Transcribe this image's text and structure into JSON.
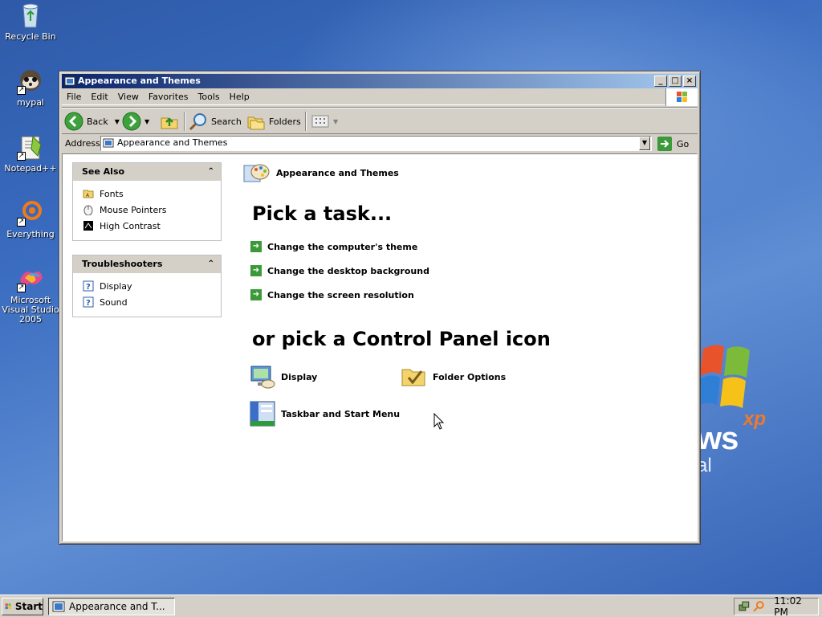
{
  "desktop": {
    "icons": [
      {
        "label": "Recycle Bin",
        "icon": "recycle-bin-icon"
      },
      {
        "label": "mypal",
        "icon": "mypal-icon"
      },
      {
        "label": "Notepad++",
        "icon": "notepadpp-icon"
      },
      {
        "label": "Everything",
        "icon": "everything-icon"
      },
      {
        "label": "Microsoft Visual Studio 2005",
        "icon": "visual-studio-icon"
      }
    ],
    "wallpaper_logo": {
      "wordmark": "ws",
      "tag": "xp",
      "edition": "al"
    }
  },
  "window": {
    "title": "Appearance and Themes",
    "menu": [
      "File",
      "Edit",
      "View",
      "Favorites",
      "Tools",
      "Help"
    ],
    "toolbar": {
      "back": "Back",
      "search": "Search",
      "folders": "Folders"
    },
    "address": {
      "label": "Address",
      "value": "Appearance and Themes",
      "go": "Go"
    },
    "left_pane": {
      "see_also": {
        "title": "See Also",
        "items": [
          "Fonts",
          "Mouse Pointers",
          "High Contrast"
        ]
      },
      "troubleshooters": {
        "title": "Troubleshooters",
        "items": [
          "Display",
          "Sound"
        ]
      }
    },
    "content": {
      "category": "Appearance and Themes",
      "pick_task": "Pick a task...",
      "tasks": [
        "Change the computer's theme",
        "Change the desktop background",
        "Change the screen resolution"
      ],
      "pick_icon": "or pick a Control Panel icon",
      "cp_icons": [
        "Display",
        "Folder Options",
        "Taskbar and Start Menu"
      ]
    }
  },
  "taskbar": {
    "start": "Start",
    "task_button": "Appearance and T...",
    "clock": "11:02 PM"
  },
  "colors": {
    "title_start": "#0a246a",
    "title_end": "#a6caf0",
    "desktop": "#3a6cc0",
    "task_arrow": "#3a9a3a"
  }
}
